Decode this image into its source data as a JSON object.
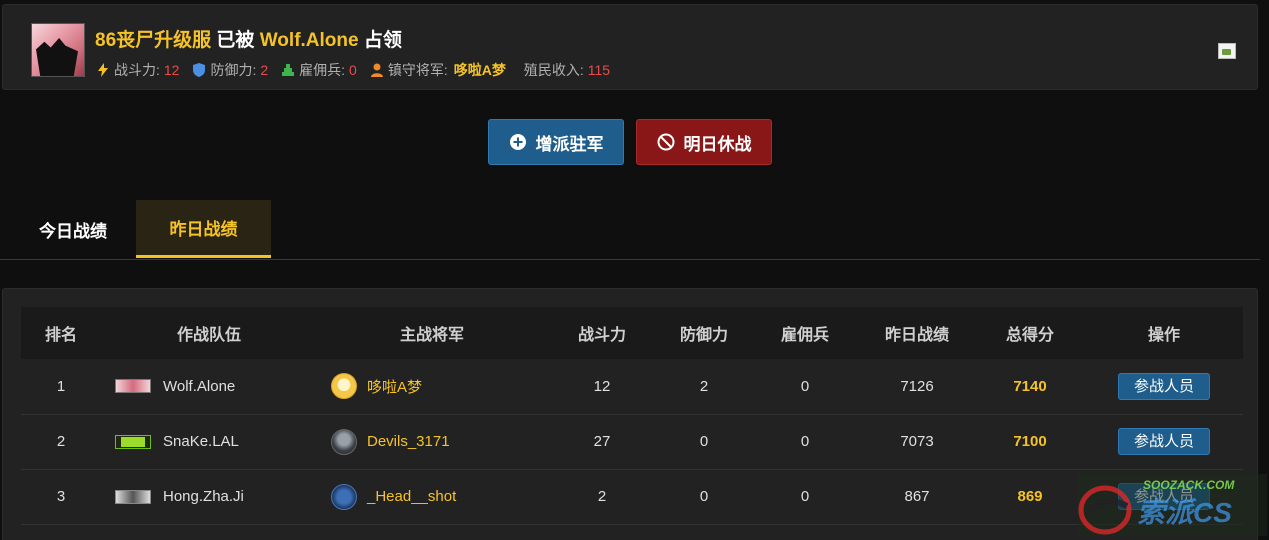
{
  "header": {
    "server_name": "86丧尸升级服",
    "occupied_by_prefix": "已被",
    "occupier": "Wolf.Alone",
    "occupied_suffix": "占领",
    "stats": {
      "attack_label": "战斗力:",
      "attack_value": "12",
      "defense_label": "防御力:",
      "defense_value": "2",
      "mercenary_label": "雇佣兵:",
      "mercenary_value": "0",
      "guard_label": "镇守将军:",
      "guard_value": "哆啦A梦",
      "income_label": "殖民收入:",
      "income_value": "115"
    }
  },
  "actions": {
    "reinforce_label": "增派驻军",
    "truce_label": "明日休战"
  },
  "tabs": [
    {
      "label": "今日战绩",
      "active": false
    },
    {
      "label": "昨日战绩",
      "active": true
    }
  ],
  "table": {
    "columns": [
      "排名",
      "作战队伍",
      "主战将军",
      "战斗力",
      "防御力",
      "雇佣兵",
      "昨日战绩",
      "总得分",
      "操作"
    ],
    "rows": [
      {
        "rank": "1",
        "team": "Wolf.Alone",
        "general": "哆啦A梦",
        "attack": "12",
        "defense": "2",
        "mercenary": "0",
        "yesterday": "7126",
        "total": "7140",
        "action": "参战人员"
      },
      {
        "rank": "2",
        "team": "SnaKe.LAL",
        "general": "Devils_3171",
        "attack": "27",
        "defense": "0",
        "mercenary": "0",
        "yesterday": "7073",
        "total": "7100",
        "action": "参战人员"
      },
      {
        "rank": "3",
        "team": "Hong.Zha.Ji",
        "general": "_Head__shot",
        "attack": "2",
        "defense": "0",
        "mercenary": "0",
        "yesterday": "867",
        "total": "869",
        "action": "参战人员"
      }
    ]
  },
  "watermark": {
    "url_text": "SOOZACK.COM",
    "brand_text": "索派CS"
  },
  "colors": {
    "gold": "#f6c327",
    "red_value": "#ea4b4b",
    "blue_button": "#1e5d8c",
    "red_button": "#8a1717"
  }
}
